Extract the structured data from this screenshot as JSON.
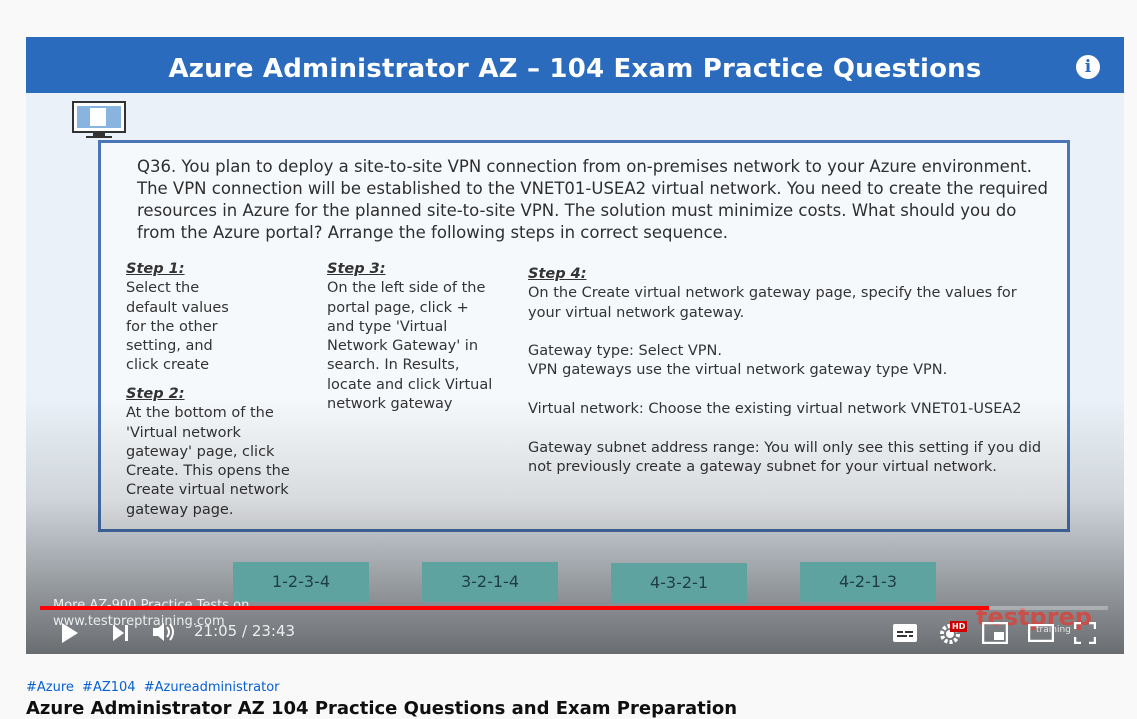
{
  "slide": {
    "title": "Azure Administrator AZ – 104 Exam Practice Questions",
    "question": "Q36. You plan to deploy a site-to-site VPN connection from on-premises network to your Azure environment. The VPN connection will be established to the VNET01-USEA2 virtual network. You need to create the required resources in Azure for the planned site-to-site VPN. The solution must minimize costs. What should you do from the Azure portal? Arrange the following steps in correct sequence.",
    "steps": [
      {
        "label": "Step 1:",
        "text": "Select the\ndefault values\nfor the other\nsetting, and\nclick create"
      },
      {
        "label": "Step 2:",
        "text": "At the bottom of the\n'Virtual network\ngateway' page, click\nCreate. This opens the\nCreate virtual network\ngateway page."
      },
      {
        "label": "Step 3:",
        "text": "On the left side of the\nportal page, click +\nand type 'Virtual\nNetwork Gateway' in\nsearch. In Results,\nlocate and click Virtual\nnetwork gateway"
      },
      {
        "label": "Step 4:",
        "text": "On the Create virtual network gateway page, specify the values for\nyour virtual network gateway.\n\nGateway type: Select VPN.\nVPN gateways use the virtual network gateway type VPN.\n\nVirtual network: Choose the existing virtual network VNET01-USEA2\n\nGateway subnet address range: You will only see this setting if you did\nnot previously create a gateway subnet for your virtual network."
      }
    ],
    "answers": [
      "1-2-3-4",
      "3-2-1-4",
      "4-3-2-1",
      "4-2-1-3"
    ],
    "promo_line1": "More AZ-900 Practice Tests on",
    "promo_line2": "www.testpreptraining.com",
    "brand": "testprep",
    "brand_sub": "training"
  },
  "player": {
    "current_time": "21:05",
    "duration": "23:43",
    "progress": 0.889,
    "hd_badge": "HD",
    "progress_color": "#ff0000"
  },
  "hashtags": [
    "#Azure",
    "#AZ104",
    "#Azureadministrator"
  ],
  "video_title": "Azure Administrator AZ 104 Practice Questions and Exam Preparation"
}
